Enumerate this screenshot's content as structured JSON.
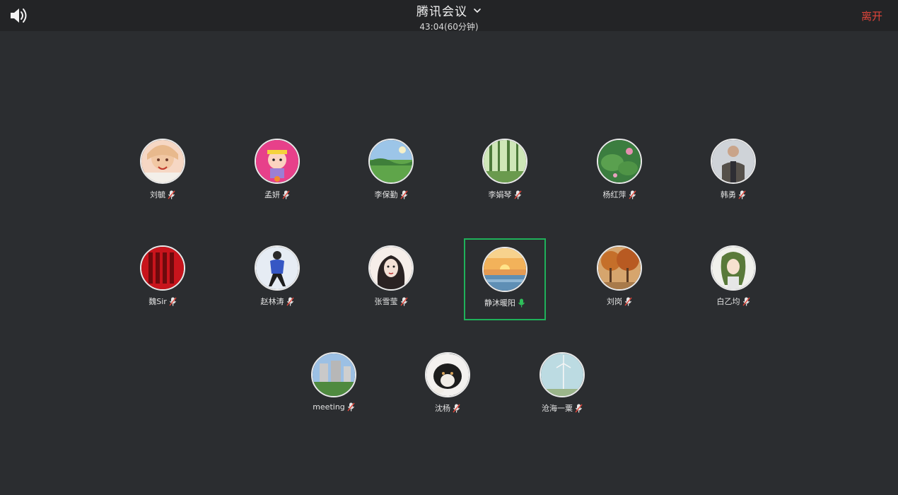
{
  "header": {
    "title": "腾讯会议",
    "timer": "43:04(60分钟)",
    "leave_label": "离开",
    "speaker_icon": "speaker-icon",
    "dropdown_icon": "chevron-down-icon"
  },
  "colors": {
    "background": "#2b2d30",
    "topbar": "#232426",
    "leave": "#e0453a",
    "active_speaker": "#1fb15a",
    "muted_mic": "#e8e8e8",
    "unmuted_mic": "#2fbf5b"
  },
  "participants": [
    {
      "name": "刘毓",
      "muted": true,
      "active": false,
      "avatar_icon": "anime-girl-avatar"
    },
    {
      "name": "孟妍",
      "muted": true,
      "active": false,
      "avatar_icon": "cartoon-girl-avatar"
    },
    {
      "name": "李保勤",
      "muted": true,
      "active": false,
      "avatar_icon": "landscape-avatar"
    },
    {
      "name": "李娟琴",
      "muted": true,
      "active": false,
      "avatar_icon": "forest-avatar"
    },
    {
      "name": "杨红萍",
      "muted": true,
      "active": false,
      "avatar_icon": "lotus-avatar"
    },
    {
      "name": "韩勇",
      "muted": true,
      "active": false,
      "avatar_icon": "person-photo-avatar"
    },
    {
      "name": "魏Sir",
      "muted": true,
      "active": false,
      "avatar_icon": "red-calligraphy-avatar"
    },
    {
      "name": "赵林涛",
      "muted": true,
      "active": false,
      "avatar_icon": "illustration-avatar"
    },
    {
      "name": "张雪莹",
      "muted": true,
      "active": false,
      "avatar_icon": "sketch-girl-avatar"
    },
    {
      "name": "静沐暖阳",
      "muted": false,
      "active": true,
      "avatar_icon": "sunset-sea-avatar"
    },
    {
      "name": "刘岗",
      "muted": true,
      "active": false,
      "avatar_icon": "autumn-trees-avatar"
    },
    {
      "name": "白乙均",
      "muted": true,
      "active": false,
      "avatar_icon": "anime-character-avatar"
    },
    {
      "name": "meeting",
      "muted": true,
      "active": false,
      "avatar_icon": "building-trees-avatar"
    },
    {
      "name": "沈杨",
      "muted": true,
      "active": false,
      "avatar_icon": "puppy-avatar"
    },
    {
      "name": "沧海一粟",
      "muted": true,
      "active": false,
      "avatar_icon": "wind-turbine-avatar"
    }
  ]
}
